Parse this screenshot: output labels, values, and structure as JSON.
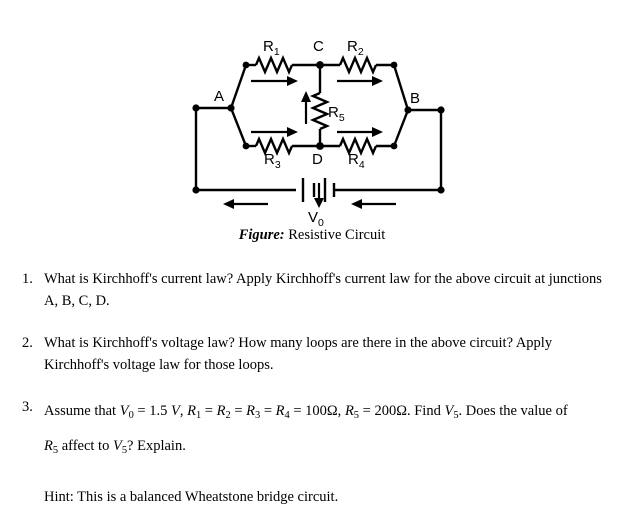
{
  "figure": {
    "caption_label": "Figure:",
    "caption_text": "Resistive Circuit",
    "node_labels": {
      "a": "A",
      "b": "B",
      "c": "C",
      "d": "D"
    },
    "resistor_labels": {
      "r1": "R",
      "r1_sub": "1",
      "r2": "R",
      "r2_sub": "2",
      "r3": "R",
      "r3_sub": "3",
      "r4": "R",
      "r4_sub": "4",
      "r5": "R",
      "r5_sub": "5"
    },
    "source_label": "V",
    "source_sub": "0",
    "current_arrows": [
      "top-left-branch-right",
      "top-right-branch-right",
      "bottom-left-branch-right",
      "bottom-right-branch-right",
      "bridge-r5-up",
      "bottom-rail-left-1",
      "bottom-rail-left-2",
      "source-down"
    ],
    "line_color": "#000000"
  },
  "questions": [
    {
      "number": "1.",
      "text": "What is Kirchhoff's current law? Apply Kirchhoff's current law for the above circuit at junctions A, B, C, D."
    },
    {
      "number": "2.",
      "text": "What is Kirchhoff's voltage law? How many loops are there in the above circuit? Apply Kirchhoff's voltage law for those loops."
    },
    {
      "number": "3.",
      "text_parts": {
        "lead": "Assume that",
        "v0": "V",
        "v0_sub": "0",
        "eq1": "= 1.5",
        "unit_v": "V",
        "comma1": ",",
        "r1": "R",
        "r1_sub": "1",
        "eq2": "=",
        "r2": "R",
        "r2_sub": "2",
        "eq3": "=",
        "r3": "R",
        "r3_sub": "3",
        "eq4": "=",
        "r4": "R",
        "r4_sub": "4",
        "eq5": "= 100Ω,",
        "r5": "R",
        "r5_sub": "5",
        "eq6": "= 200Ω.",
        "find": "Find",
        "v5": "V",
        "v5_sub": "5",
        "tail1": ". Does the value of",
        "r5b": "R",
        "r5b_sub": "5",
        "tail2": "affect to",
        "v5b": "V",
        "v5b_sub": "5",
        "tail3": "? Explain."
      }
    }
  ],
  "hint": "Hint: This is a balanced Wheatstone bridge circuit."
}
